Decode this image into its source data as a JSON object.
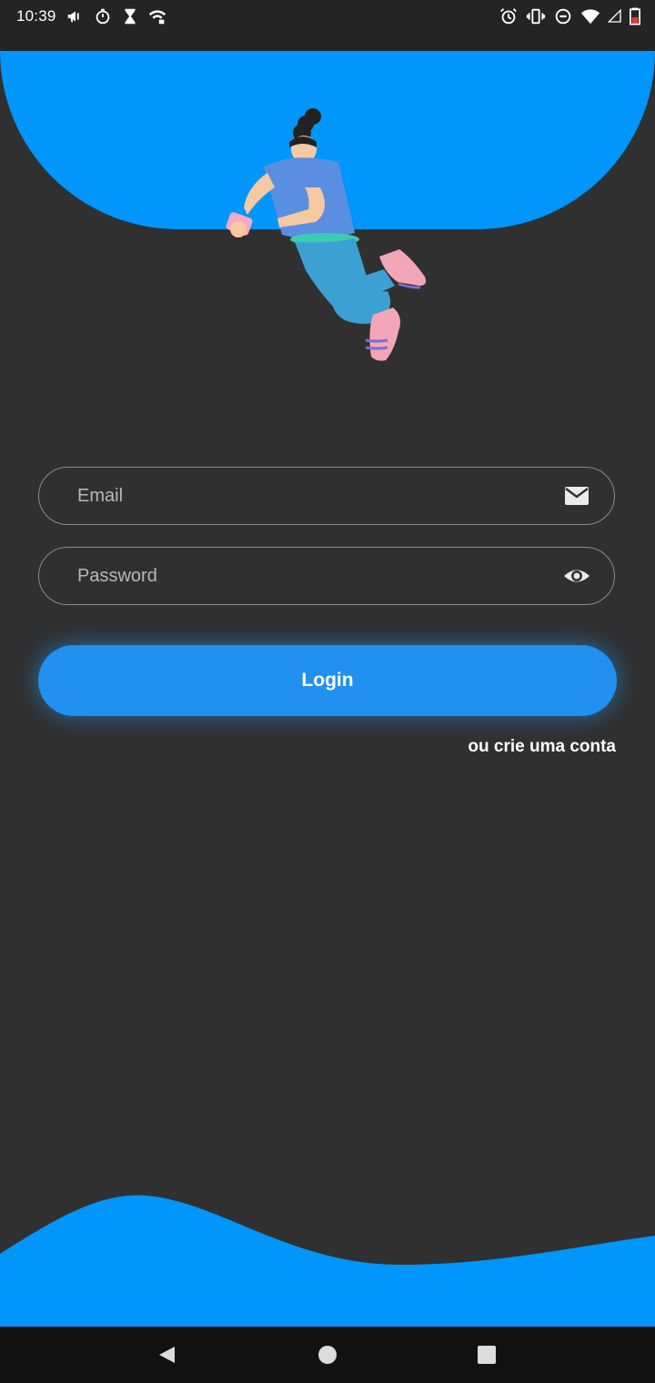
{
  "status_bar": {
    "time": "10:39",
    "left_icons": [
      "megaphone-icon",
      "stopwatch-icon",
      "hourglass-icon",
      "wifi-calling-icon"
    ],
    "right_icons": [
      "alarm-icon",
      "vibrate-icon",
      "do-not-disturb-icon",
      "wifi-icon",
      "cell-signal-icon",
      "battery-icon"
    ]
  },
  "form": {
    "email": {
      "placeholder": "Email",
      "value": "",
      "icon": "mail-icon"
    },
    "password": {
      "placeholder": "Password",
      "value": "",
      "icon": "eye-icon"
    },
    "login_label": "Login",
    "create_account_label": "ou crie uma conta"
  },
  "colors": {
    "background": "#303030",
    "accent": "#0096fb",
    "button": "#2190ef",
    "text": "#ffffff"
  }
}
